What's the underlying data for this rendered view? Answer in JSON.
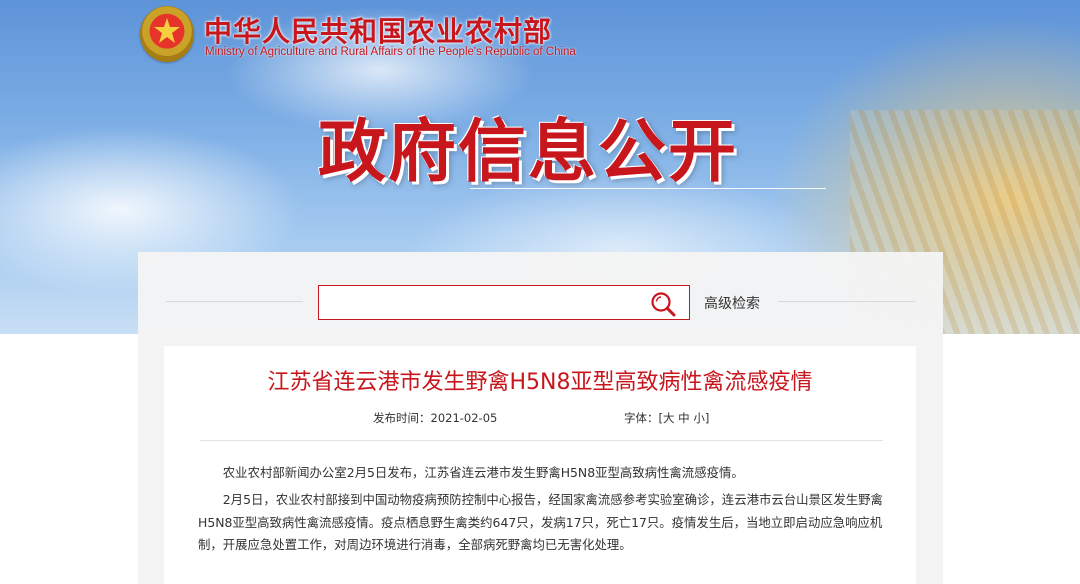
{
  "header": {
    "ministry_cn": "中华人民共和国农业农村部",
    "ministry_en": "Ministry of Agriculture and Rural Affairs of the People's Republic of China",
    "section_title": "政府信息公开",
    "emblem_icon": "national-emblem-icon"
  },
  "search": {
    "placeholder": "",
    "value": "",
    "icon": "search-icon",
    "advanced_label": "高级检索"
  },
  "article": {
    "title": "江苏省连云港市发生野禽H5N8亚型高致病性禽流感疫情",
    "date_label": "发布时间：",
    "date_value": "2021-02-05",
    "font_label": "字体：",
    "font_open": "[",
    "font_large": "大",
    "font_medium": "中",
    "font_small": "小",
    "font_close": "]",
    "paragraphs": [
      "农业农村部新闻办公室2月5日发布，江苏省连云港市发生野禽H5N8亚型高致病性禽流感疫情。",
      "2月5日，农业农村部接到中国动物疫病预防控制中心报告，经国家禽流感参考实验室确诊，连云港市云台山景区发生野禽H5N8亚型高致病性禽流感疫情。疫点栖息野生禽类约647只，发病17只，死亡17只。疫情发生后，当地立即启动应急响应机制，开展应急处置工作，对周边环境进行消毒，全部病死野禽均已无害化处理。"
    ]
  },
  "colors": {
    "brand_red": "#c8161d",
    "sky_blue": "#7fb0e6",
    "panel_gray": "#f4f4f4"
  }
}
